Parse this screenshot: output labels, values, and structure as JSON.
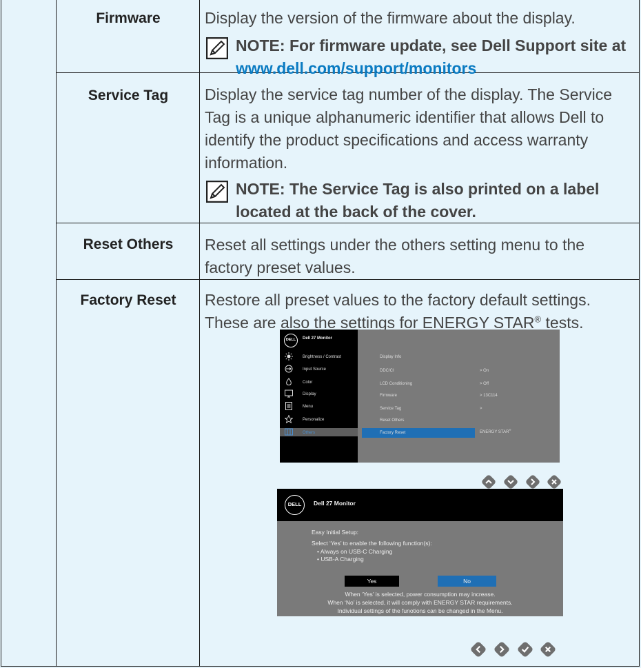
{
  "rows": [
    {
      "label": "Firmware",
      "description": "Display the version of the firmware about the display.",
      "note": {
        "text": "NOTE: For firmware update, see Dell Support site at ",
        "link": "www.dell.com/support/monitors"
      }
    },
    {
      "label": "Service Tag",
      "description": "Display the service tag number of the display. The Service Tag is a unique alphanumeric identifier that allows Dell to identify the product specifications and access warranty information.",
      "note": {
        "text": "NOTE: The Service Tag is also printed on a label located at the back of the cover."
      }
    },
    {
      "label": "Reset Others",
      "description": "Reset all settings under the others setting menu to the factory preset values."
    },
    {
      "label": "Factory Reset",
      "description": "Restore all preset values to the factory default settings. These are also the settings for ENERGY STAR",
      "description_tail": " tests.",
      "registered": "®"
    }
  ],
  "osd_menu": {
    "logo": "DELL",
    "title": "Dell 27 Monitor",
    "left_items": [
      {
        "label": "Brightness / Contrast",
        "icon": "brightness-icon"
      },
      {
        "label": "Input Source",
        "icon": "input-source-icon"
      },
      {
        "label": "Color",
        "icon": "color-icon"
      },
      {
        "label": "Display",
        "icon": "display-icon"
      },
      {
        "label": "Menu",
        "icon": "menu-icon"
      },
      {
        "label": "Personalize",
        "icon": "star-icon"
      },
      {
        "label": "Others",
        "icon": "others-icon"
      }
    ],
    "right_items": [
      {
        "label": "Display Info",
        "value": ""
      },
      {
        "label": "DDC/CI",
        "value": ">  On"
      },
      {
        "label": "LCD Conditioning",
        "value": ">  Off"
      },
      {
        "label": "Firmware",
        "value": ">  13C114"
      },
      {
        "label": "Service Tag",
        "value": ">"
      },
      {
        "label": "Reset Others",
        "value": ""
      },
      {
        "label": "Factory Reset",
        "value": "ENERGY STAR"
      }
    ],
    "registered": "®",
    "buttons": [
      "up-icon",
      "down-icon",
      "right-icon",
      "close-icon"
    ]
  },
  "osd_dialog": {
    "logo": "DELL",
    "title": "Dell 27 Monitor",
    "heading": "Easy Initial Setup:",
    "prompt": "Select ‘Yes’ to enable the following function(s):",
    "bullets": [
      "• Always on USB-C Charging",
      "• USB-A Charging"
    ],
    "yes": "Yes",
    "no": "No",
    "info": [
      "When ‘Yes’ is selected, power consumption may increase.",
      "When ‘No’ is selected, it will comply with ENERGY STAR requirements.",
      "Individual settings of the funotions can be changed in the Menu."
    ],
    "buttons": [
      "left-icon",
      "right-icon",
      "check-icon",
      "close-icon"
    ]
  },
  "colors": {
    "background": "#e6f4fb",
    "link": "#0a7bc2",
    "osd_select": "#1f6fb5",
    "osd_panel": "#7a7a7a"
  }
}
